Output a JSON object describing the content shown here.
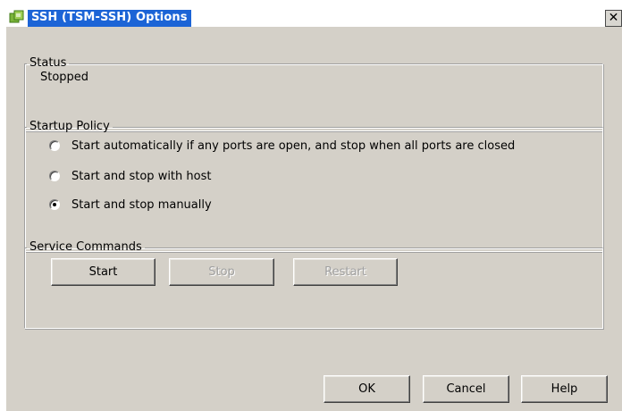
{
  "window": {
    "title": "SSH (TSM-SSH) Options",
    "close_label": "✕"
  },
  "status": {
    "legend": "Status",
    "value": "Stopped"
  },
  "startup_policy": {
    "legend": "Startup Policy",
    "options": [
      {
        "label": "Start automatically if any ports are open, and stop when all ports are closed",
        "checked": false
      },
      {
        "label": "Start and stop with host",
        "checked": false
      },
      {
        "label": "Start and stop manually",
        "checked": true
      }
    ]
  },
  "service_commands": {
    "legend": "Service Commands",
    "start_label": "Start",
    "stop_label": "Stop",
    "restart_label": "Restart"
  },
  "footer": {
    "ok_label": "OK",
    "cancel_label": "Cancel",
    "help_label": "Help"
  },
  "colors": {
    "title_highlight": "#1c64d6",
    "dialog_bg": "#d4d0c8"
  }
}
